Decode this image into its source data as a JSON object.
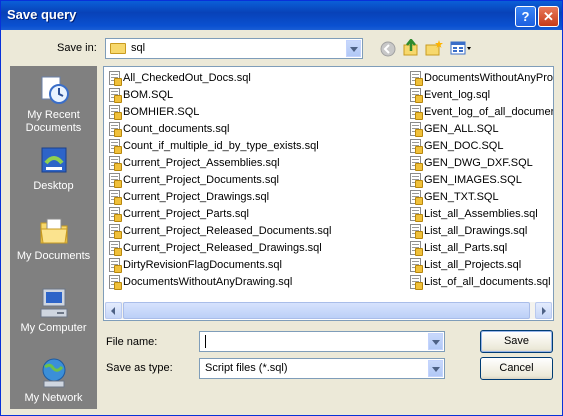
{
  "window": {
    "title": "Save query"
  },
  "titlebar_buttons": {
    "help": "?",
    "close": "✕"
  },
  "save_in": {
    "label": "Save in:",
    "value": "sql"
  },
  "places": [
    {
      "label": "My Recent Documents",
      "icon": "recent-documents-icon"
    },
    {
      "label": "Desktop",
      "icon": "desktop-icon"
    },
    {
      "label": "My Documents",
      "icon": "my-documents-icon"
    },
    {
      "label": "My Computer",
      "icon": "my-computer-icon"
    },
    {
      "label": "My Network",
      "icon": "my-network-icon"
    }
  ],
  "files_col1": [
    "All_CheckedOut_Docs.sql",
    "BOM.SQL",
    "BOMHIER.SQL",
    "Count_documents.sql",
    "Count_if_multiple_id_by_type_exists.sql",
    "Current_Project_Assemblies.sql",
    "Current_Project_Documents.sql",
    "Current_Project_Drawings.sql",
    "Current_Project_Parts.sql",
    "Current_Project_Released_Documents.sql",
    "Current_Project_Released_Drawings.sql",
    "DirtyRevisionFlagDocuments.sql",
    "DocumentsWithoutAnyDrawing.sql"
  ],
  "files_col2": [
    "DocumentsWithoutAnyPro",
    "Event_log.sql",
    "Event_log_of_all_documer",
    "GEN_ALL.SQL",
    "GEN_DOC.SQL",
    "GEN_DWG_DXF.SQL",
    "GEN_IMAGES.SQL",
    "GEN_TXT.SQL",
    "List_all_Assemblies.sql",
    "List_all_Drawings.sql",
    "List_all_Parts.sql",
    "List_all_Projects.sql",
    "List_of_all_documents.sql"
  ],
  "file_name": {
    "label": "File name:",
    "value": ""
  },
  "save_as_type": {
    "label": "Save as type:",
    "value": "Script files (*.sql)"
  },
  "buttons": {
    "save": "Save",
    "cancel": "Cancel"
  }
}
